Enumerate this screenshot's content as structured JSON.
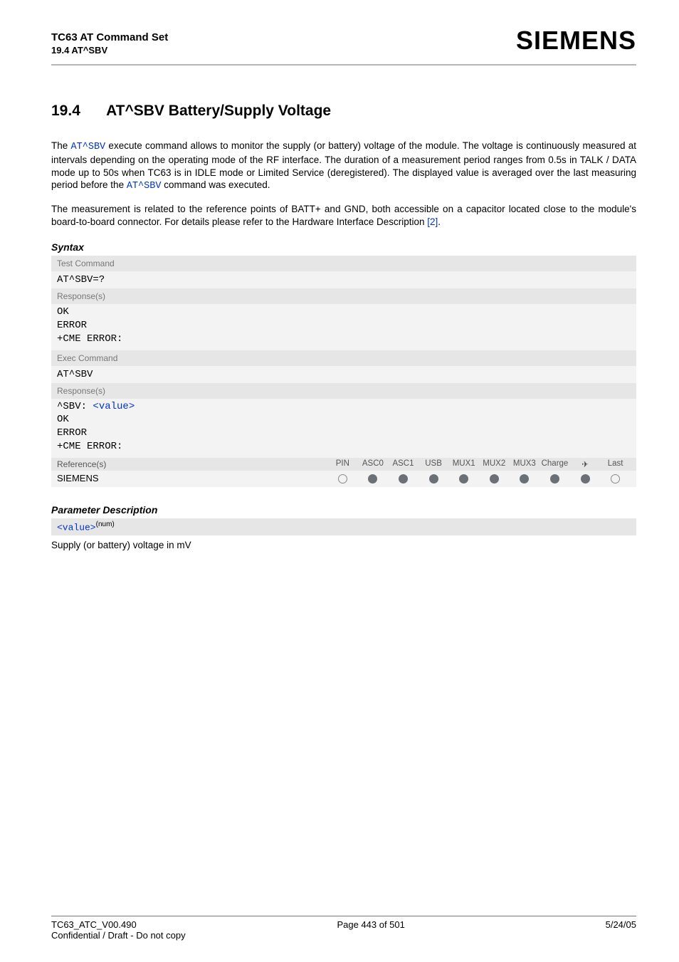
{
  "header": {
    "title": "TC63 AT Command Set",
    "subtitle": "19.4 AT^SBV",
    "logo": "SIEMENS"
  },
  "section": {
    "number": "19.4",
    "title": "AT^SBV   Battery/Supply Voltage"
  },
  "para1_a": "The ",
  "para1_cmd": "AT^SBV",
  "para1_b": " execute command allows to monitor the supply (or battery) voltage of the module. The voltage is continuously measured at intervals depending on the operating mode of the RF interface. The duration of a measurement period ranges from 0.5s in TALK / DATA mode up to 50s when TC63 is in IDLE mode or Limited Service (deregistered). The displayed value is averaged over the last measuring period before the ",
  "para1_cmd2": "AT^SBV",
  "para1_c": " command was executed.",
  "para2_a": "The measurement is related to the reference points of BATT+ and GND, both accessible on a capacitor located close to the module's board-to-board connector. For details please refer to the Hardware Interface Description ",
  "para2_ref": "[2]",
  "para2_b": ".",
  "syntax_heading": "Syntax",
  "syntax": {
    "test_label": "Test Command",
    "test_cmd": "AT^SBV=?",
    "test_resp_label": "Response(s)",
    "test_resp": "OK\nERROR\n+CME ERROR:",
    "exec_label": "Exec Command",
    "exec_cmd": "AT^SBV",
    "exec_resp_label": "Response(s)",
    "exec_resp_pre": "^SBV: ",
    "exec_resp_val": "<value>",
    "exec_resp_post": "\nOK\nERROR\n+CME ERROR:",
    "ref_label": "Reference(s)",
    "ref_value": "SIEMENS",
    "cols": [
      "PIN",
      "ASC0",
      "ASC1",
      "USB",
      "MUX1",
      "MUX2",
      "MUX3",
      "Charge",
      "✈",
      "Last"
    ],
    "states": [
      "open",
      "fill",
      "fill",
      "fill",
      "fill",
      "fill",
      "fill",
      "fill",
      "fill",
      "open"
    ]
  },
  "param_heading": "Parameter Description",
  "param_name": "<value>",
  "param_sup": "(num)",
  "param_desc": "Supply (or battery) voltage in mV",
  "footer": {
    "left": "TC63_ATC_V00.490",
    "center": "Page 443 of 501",
    "right": "5/24/05",
    "left2": "Confidential / Draft - Do not copy"
  }
}
